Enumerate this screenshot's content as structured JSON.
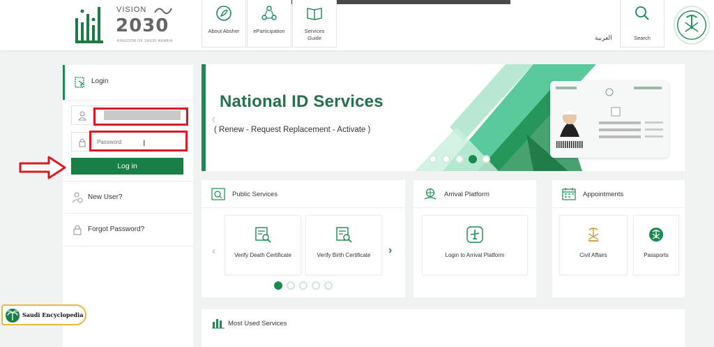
{
  "header": {
    "vision_label": "VISION",
    "vision_year": "2030",
    "vision_kingdom": "KINGDOM OF SAUDI ARABIA",
    "nav": [
      {
        "label": "About Absher"
      },
      {
        "label": "eParticipation"
      },
      {
        "label": "Services Guide"
      },
      {
        "label": "Search"
      }
    ],
    "language_link": "العربية"
  },
  "sidebar": {
    "login_title": "Login",
    "username": {
      "placeholder": ""
    },
    "password": {
      "placeholder": "Password"
    },
    "login_button": "Log in",
    "links": [
      {
        "label": "New User?"
      },
      {
        "label": "Forgot Password?"
      }
    ]
  },
  "banner": {
    "title": "National ID Services",
    "subtitle": "( Renew - Request Replacement - Activate )",
    "slide_count": 5,
    "active_slide": 4
  },
  "public_services": {
    "title": "Public Services",
    "items": [
      {
        "label": "Verify Death Certificate"
      },
      {
        "label": "Verify Birth Certificate"
      }
    ],
    "page_count": 5,
    "active_page": 1
  },
  "arrival_platform": {
    "title": "Arrival Platform",
    "items": [
      {
        "label": "Login to Arrival Platform"
      }
    ]
  },
  "appointments": {
    "title": "Appointments",
    "items": [
      {
        "label": "Civil Affairs"
      },
      {
        "label": "Passports"
      }
    ]
  },
  "most_used": {
    "title": "Most Used Services"
  },
  "watermark": {
    "text": "Saudi Encyclopedia"
  },
  "colors": {
    "brand_green": "#1a8a4e",
    "button_green": "#1a7f47",
    "highlight_red": "#d91a24"
  }
}
